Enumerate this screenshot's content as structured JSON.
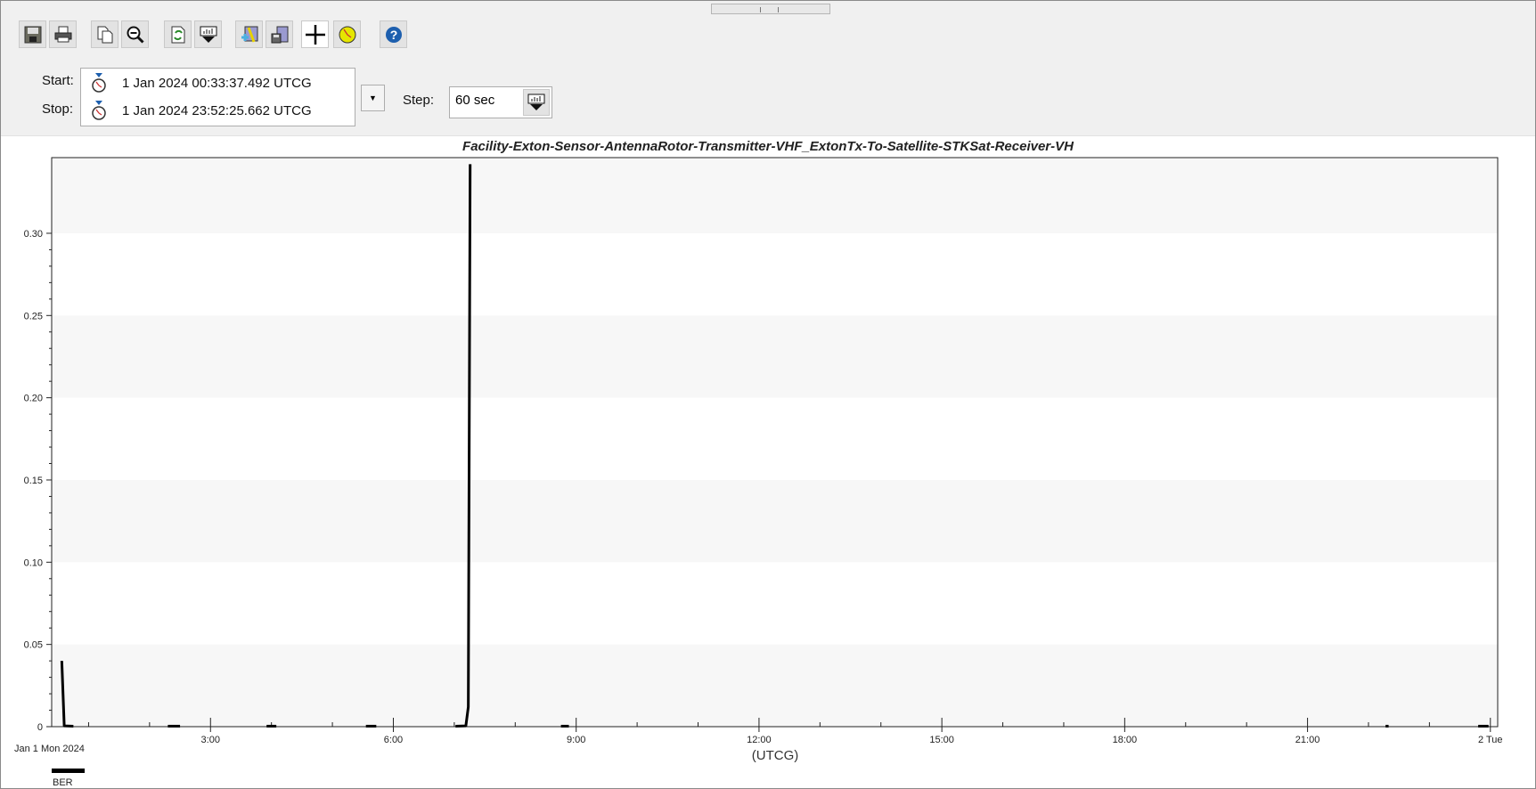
{
  "toolbar": {
    "buttons": [
      {
        "name": "save-icon",
        "tip": "Save"
      },
      {
        "name": "print-icon",
        "tip": "Print"
      },
      {
        "name": "copy-icon",
        "tip": "Copy"
      },
      {
        "name": "zoom-out-icon",
        "tip": "Zoom out"
      },
      {
        "name": "refresh-icon",
        "tip": "Refresh"
      },
      {
        "name": "report-options-icon",
        "tip": "Options"
      },
      {
        "name": "add-data-icon",
        "tip": "Add"
      },
      {
        "name": "save-style-icon",
        "tip": "Save style"
      },
      {
        "name": "crosshair-icon",
        "tip": "Crosshair"
      },
      {
        "name": "clock-icon",
        "tip": "Time"
      },
      {
        "name": "help-icon",
        "tip": "Help"
      }
    ]
  },
  "time": {
    "start_label": "Start:",
    "start_value": "1 Jan 2024 00:33:37.492 UTCG",
    "stop_label": "Stop:",
    "stop_value": "1 Jan 2024 23:52:25.662 UTCG",
    "step_label": "Step:",
    "step_value": "60 sec"
  },
  "colors": {
    "line": "#000000",
    "band": "#f7f7f7",
    "toolbar": "#f0f0f0"
  },
  "chart_data": {
    "type": "line",
    "title": "Facility-Exton-Sensor-AntennaRotor-Transmitter-VHF_ExtonTx-To-Satellite-STKSat-Receiver-VH",
    "xlabel": "(UTCG)",
    "date_label": "Jan 1 Mon 2024",
    "ylabel": "",
    "xlim_hours": [
      0.394,
      24.12
    ],
    "ylim": [
      0,
      0.346
    ],
    "yticks": [
      0,
      0.05,
      0.1,
      0.15,
      0.2,
      0.25,
      0.3
    ],
    "ytick_labels": [
      "0",
      "0.05",
      "0.10",
      "0.15",
      "0.20",
      "0.25",
      "0.30"
    ],
    "xticks_hours": [
      3,
      6,
      9,
      12,
      15,
      18,
      21,
      24
    ],
    "xtick_labels": [
      "3:00",
      "6:00",
      "9:00",
      "12:00",
      "15:00",
      "18:00",
      "21:00",
      "2 Tue"
    ],
    "grid": "alternating horizontal bands",
    "legend": {
      "placement": "bottom-left",
      "entries": [
        "BER"
      ]
    },
    "series": [
      {
        "name": "BER",
        "segments": [
          [
            [
              0.56,
              0.04
            ],
            [
              0.6,
              0.0005
            ],
            [
              0.75,
              0.0003
            ]
          ],
          [
            [
              2.3,
              0.0003
            ],
            [
              2.5,
              0.0003
            ]
          ],
          [
            [
              3.92,
              0.0003
            ],
            [
              4.08,
              0.0003
            ]
          ],
          [
            [
              5.55,
              0.0003
            ],
            [
              5.72,
              0.0003
            ]
          ],
          [
            [
              7.02,
              0.0003
            ],
            [
              7.19,
              0.0005
            ],
            [
              7.23,
              0.012
            ],
            [
              7.26,
              0.342
            ]
          ],
          [
            [
              8.75,
              0.0003
            ],
            [
              8.88,
              0.0003
            ]
          ],
          [
            [
              22.28,
              0.0003
            ],
            [
              22.33,
              0.0003
            ]
          ],
          [
            [
              23.8,
              0.0003
            ],
            [
              23.97,
              0.0003
            ]
          ]
        ]
      }
    ]
  }
}
